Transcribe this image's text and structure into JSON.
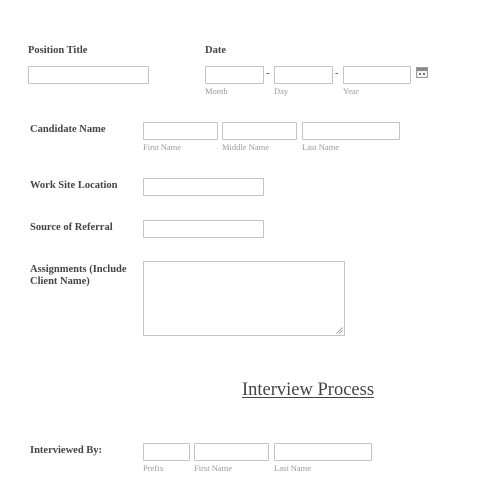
{
  "position_title": {
    "label": "Position Title",
    "value": ""
  },
  "date": {
    "label": "Date",
    "month": {
      "value": "",
      "sublabel": "Month"
    },
    "day": {
      "value": "",
      "sublabel": "Day"
    },
    "year": {
      "value": "",
      "sublabel": "Year"
    },
    "separator": "-",
    "calendar_icon": "calendar-icon"
  },
  "candidate_name": {
    "label": "Candidate Name",
    "first": {
      "value": "",
      "sublabel": "First Name"
    },
    "middle": {
      "value": "",
      "sublabel": "Middle Name"
    },
    "last": {
      "value": "",
      "sublabel": "Last Name"
    }
  },
  "work_site_location": {
    "label": "Work Site Location",
    "value": ""
  },
  "source_of_referral": {
    "label": "Source of Referral",
    "value": ""
  },
  "assignments": {
    "label": "Assignments (Include Client Name)",
    "value": ""
  },
  "section_heading": "Interview Process",
  "interviewed_by": {
    "label": "Interviewed By:",
    "prefix": {
      "value": "",
      "sublabel": "Prefix"
    },
    "first": {
      "value": "",
      "sublabel": "First Name"
    },
    "last": {
      "value": "",
      "sublabel": "Last Name"
    }
  }
}
